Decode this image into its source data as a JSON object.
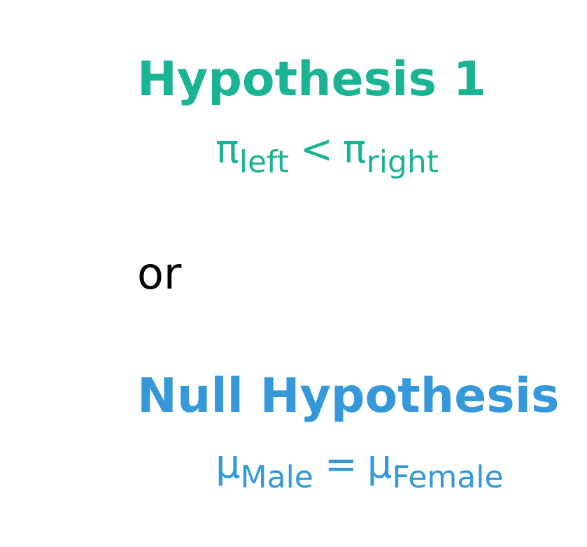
{
  "hypothesis1": {
    "title": "Hypothesis 1",
    "color": "#1ab394",
    "expression": {
      "lhs_symbol": "π",
      "lhs_subscript": "left",
      "operator": "<",
      "rhs_symbol": "π",
      "rhs_subscript": "right"
    }
  },
  "separator": {
    "text": "or",
    "color": "#000000"
  },
  "null_hypothesis": {
    "title": "Null Hypothesis",
    "color": "#3498db",
    "expression": {
      "lhs_symbol": "μ",
      "lhs_subscript": "Male",
      "operator": "=",
      "rhs_symbol": "μ",
      "rhs_subscript": "Female"
    }
  }
}
